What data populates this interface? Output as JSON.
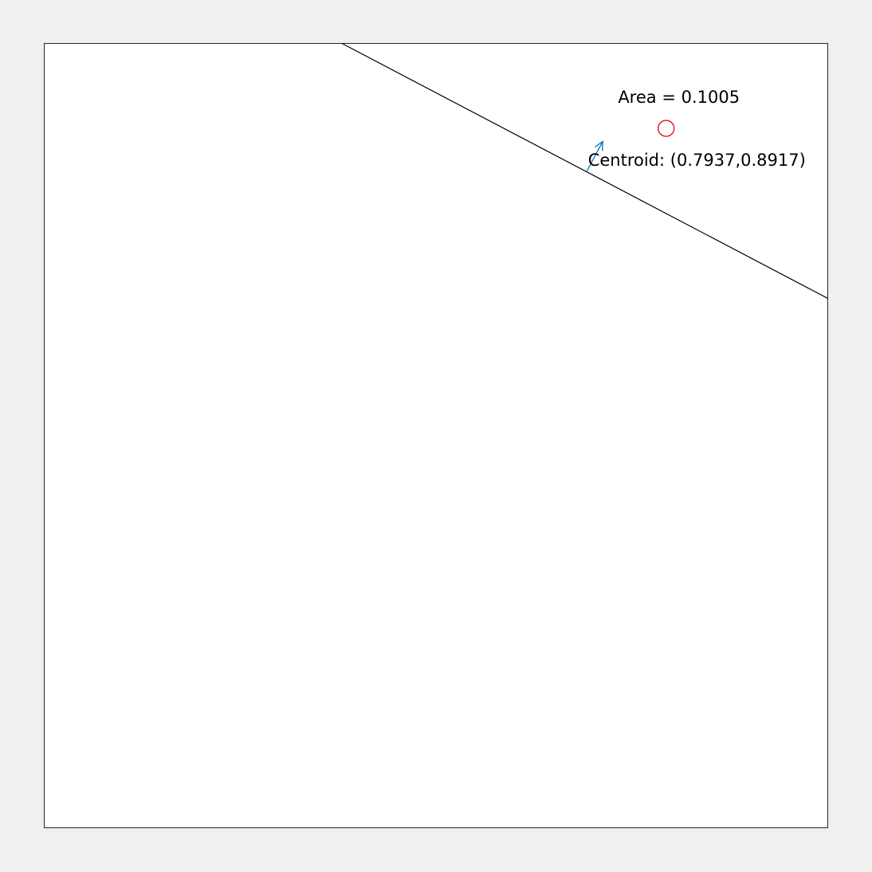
{
  "annotations": {
    "area_label": "Area = 0.1005",
    "centroid_label": "Centroid: (0.7937,0.8917)"
  },
  "geometry": {
    "axis_limits": {
      "x": [
        0,
        1
      ],
      "y": [
        0,
        1
      ]
    },
    "cut_line": {
      "p1": [
        0.38,
        1.0
      ],
      "p2": [
        1.0,
        0.675
      ]
    },
    "centroid": [
      0.7937,
      0.8917
    ],
    "normal_arrow": {
      "from": [
        0.6917,
        0.8355
      ],
      "to": [
        0.7128,
        0.8751
      ]
    }
  },
  "colors": {
    "background": "#f0f0f0",
    "axes_face": "#ffffff",
    "axes_edge": "#262626",
    "line": "#000000",
    "centroid_marker": "#e8000b",
    "arrow": "#0072bd",
    "text": "#000000"
  }
}
